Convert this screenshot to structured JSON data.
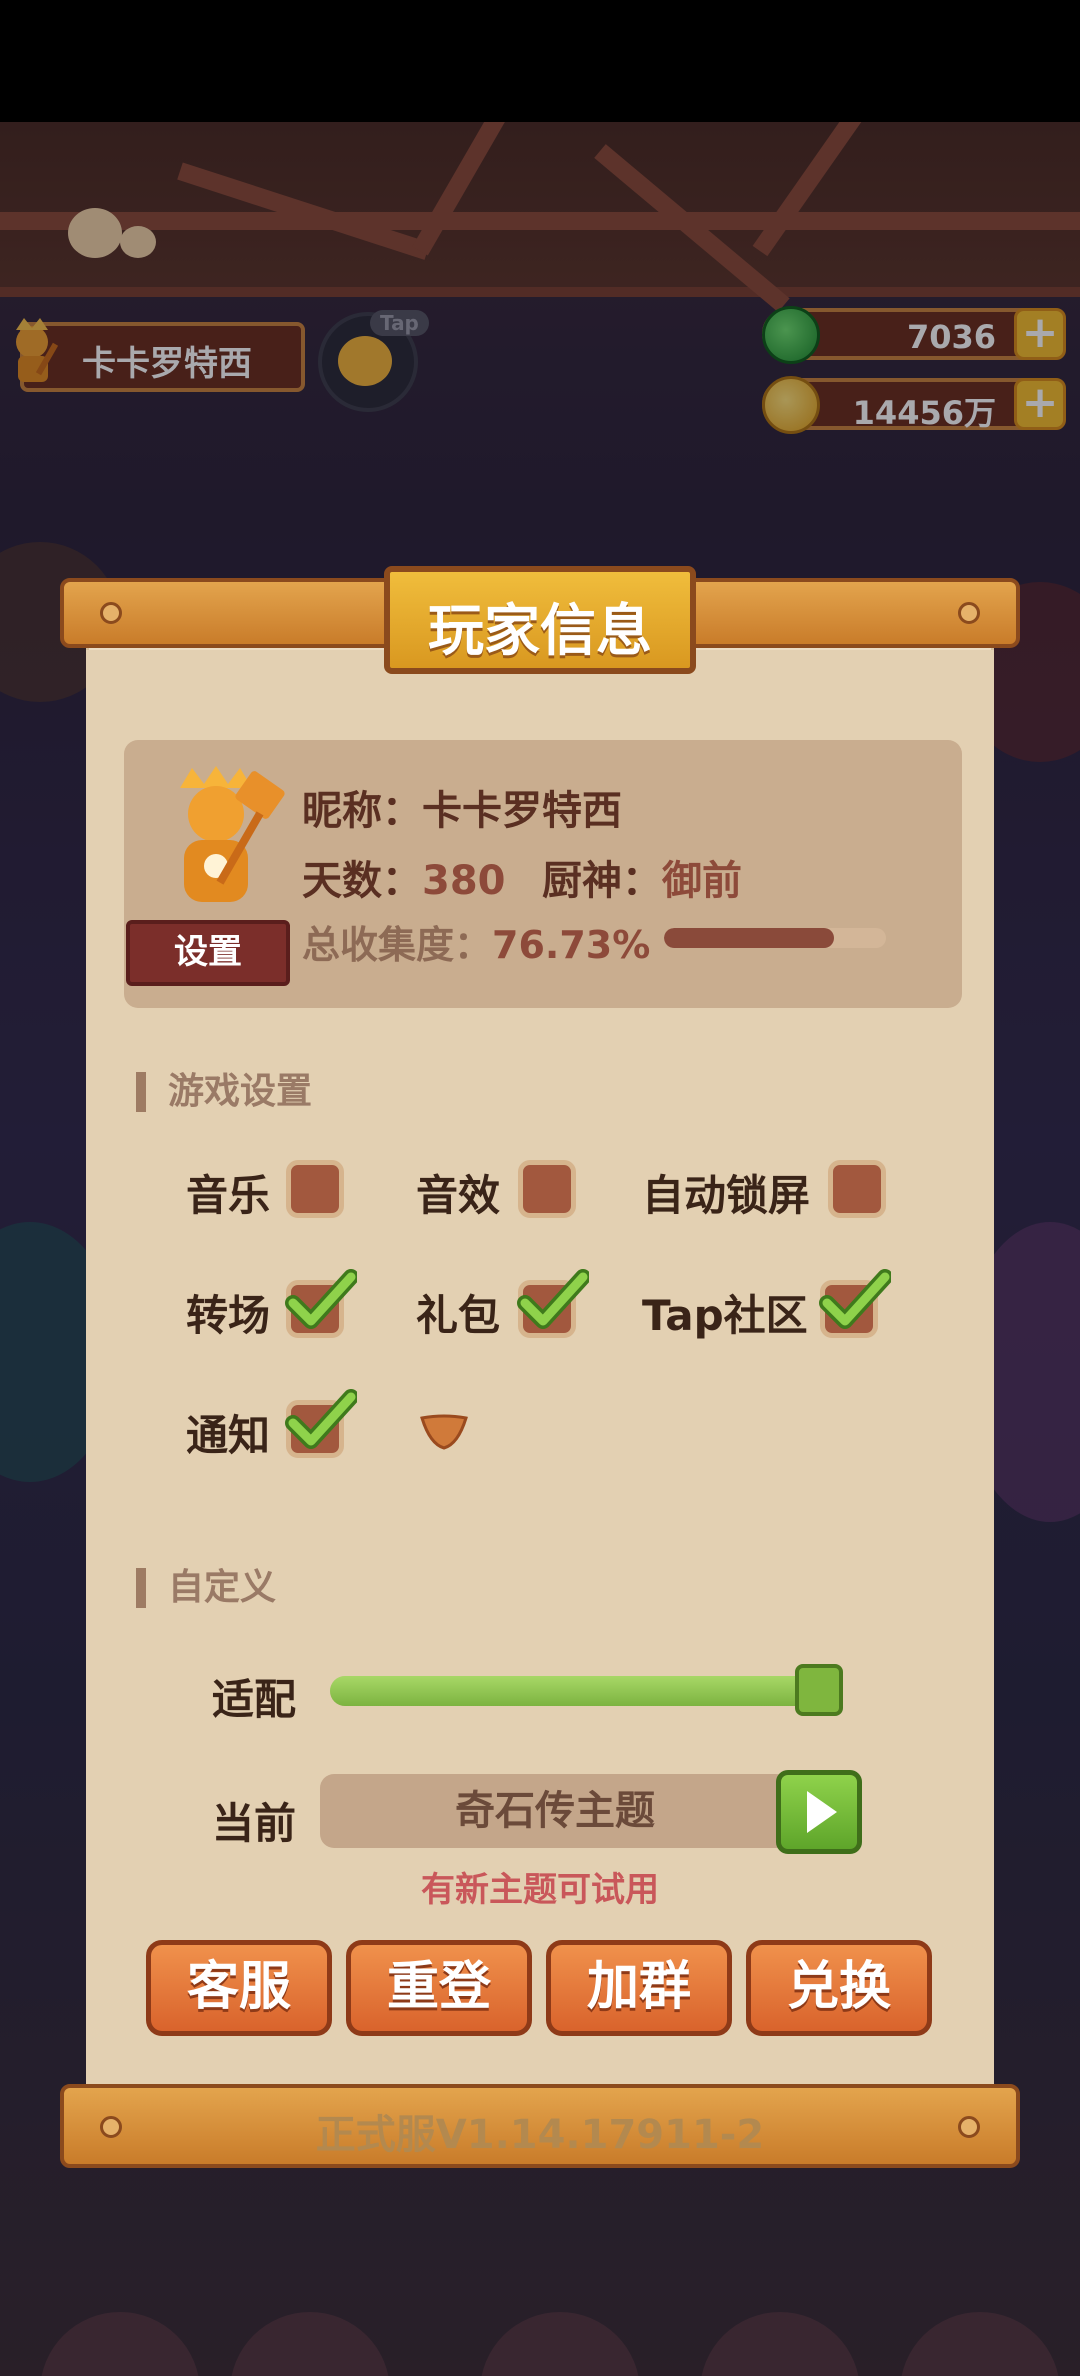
{
  "hud": {
    "player_name": "卡卡罗特西",
    "tap_label": "Tap",
    "resources": [
      {
        "name": "jade",
        "value": "7036",
        "color": "#3cbc3c"
      },
      {
        "name": "coin",
        "value": "14456万",
        "color": "#f3c12e"
      }
    ],
    "plus_label": "+"
  },
  "panel": {
    "title": "玩家信息",
    "profile": {
      "nickname_label": "昵称：",
      "nickname": "卡卡罗特西",
      "days_label": "天数：",
      "days": "380",
      "chef_label": "厨神：",
      "chef": "御前",
      "collection_label": "总收集度：",
      "collection": "76.73%",
      "collection_progress": 0.7673,
      "settings_button": "设置"
    },
    "game_settings": {
      "heading": "游戏设置",
      "options": [
        {
          "label": "音乐",
          "checked": false
        },
        {
          "label": "音效",
          "checked": false
        },
        {
          "label": "自动锁屏",
          "checked": false
        },
        {
          "label": "转场",
          "checked": true
        },
        {
          "label": "礼包",
          "checked": true
        },
        {
          "label": "Tap社区",
          "checked": true
        },
        {
          "label": "通知",
          "checked": true
        }
      ]
    },
    "custom": {
      "heading": "自定义",
      "fit_label": "适配",
      "fit_value": 1.0,
      "current_label": "当前",
      "current_theme": "奇石传主题",
      "hint": "有新主题可试用"
    },
    "actions": [
      "客服",
      "重登",
      "加群",
      "兑换"
    ],
    "version": "正式服V1.14.17911-2"
  },
  "colors": {
    "accent_orange": "#e4793a",
    "check_green": "#7cc142",
    "panel_bg": "#e3d0b2"
  }
}
